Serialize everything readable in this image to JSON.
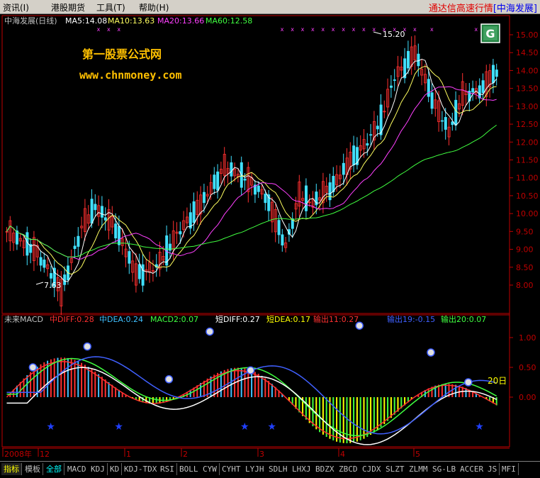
{
  "menu": {
    "items": [
      "资讯(I)",
      "港股期货",
      "工具(T)",
      "帮助(H)"
    ],
    "brand_red": "通达信高速行情",
    "brand_blue": "[中海发展]"
  },
  "price_panel": {
    "title": "中海发展(日线)",
    "indicators": [
      {
        "label": "MA5:14.08",
        "color": "#ffffff"
      },
      {
        "label": "MA10:13.63",
        "color": "#ffff60"
      },
      {
        "label": "MA20:13.66",
        "color": "#ff40ff"
      },
      {
        "label": "MA60:12.58",
        "color": "#40ff40"
      }
    ],
    "watermark_cn": "第一股票公式网",
    "watermark_url": "www.chnmoney.com",
    "high_label": "15.20",
    "low_label": "7.63",
    "y_ticks": [
      "15.00",
      "14.50",
      "14.00",
      "13.50",
      "13.00",
      "12.50",
      "12.00",
      "11.50",
      "11.00",
      "10.50",
      "10.00",
      "9.50",
      "9.00",
      "8.50",
      "8.00"
    ]
  },
  "macd_panel": {
    "title": "未来MACD",
    "indicators": [
      {
        "label": "中DIFF:0.28",
        "color": "#ff3030"
      },
      {
        "label": "中DEA:0.24",
        "color": "#40c0ff"
      },
      {
        "label": "MACD2:0.07",
        "color": "#40ff40"
      },
      {
        "label": "短DIFF:0.27",
        "color": "#ffffff"
      },
      {
        "label": "短DEA:0.17",
        "color": "#ffff00"
      },
      {
        "label": "输出11:0.27",
        "color": "#ff3030"
      },
      {
        "label": "输出19:-0.15",
        "color": "#4060ff"
      },
      {
        "label": "输出20:0.07",
        "color": "#40ff40"
      }
    ],
    "y_ticks": [
      "1.00",
      "0.50",
      "0.00"
    ],
    "annotation": "20日"
  },
  "time_axis": {
    "labels": [
      "2008年",
      "12",
      "1",
      "2",
      "3",
      "4",
      "5"
    ]
  },
  "tabs": [
    "指标",
    "模板",
    "全部",
    "MACD",
    "KDJ",
    "KD",
    "KDJ-TDX",
    "RSI",
    "BOLL",
    "CYW",
    "CYHT",
    "LYJH",
    "SDLH",
    "LHXJ",
    "BDZX",
    "ZBCD",
    "CJDX",
    "SLZT",
    "ZLMM",
    "SG-LB",
    "ACCER",
    "JS",
    "MFI"
  ],
  "colors": {
    "up": "#ff3030",
    "down": "#40e0ff",
    "axis": "#c00000",
    "ma5": "#ffffff",
    "ma10": "#ffff60",
    "ma20": "#ff40ff",
    "ma60": "#40ff40",
    "watermark": "#ffc000"
  }
}
